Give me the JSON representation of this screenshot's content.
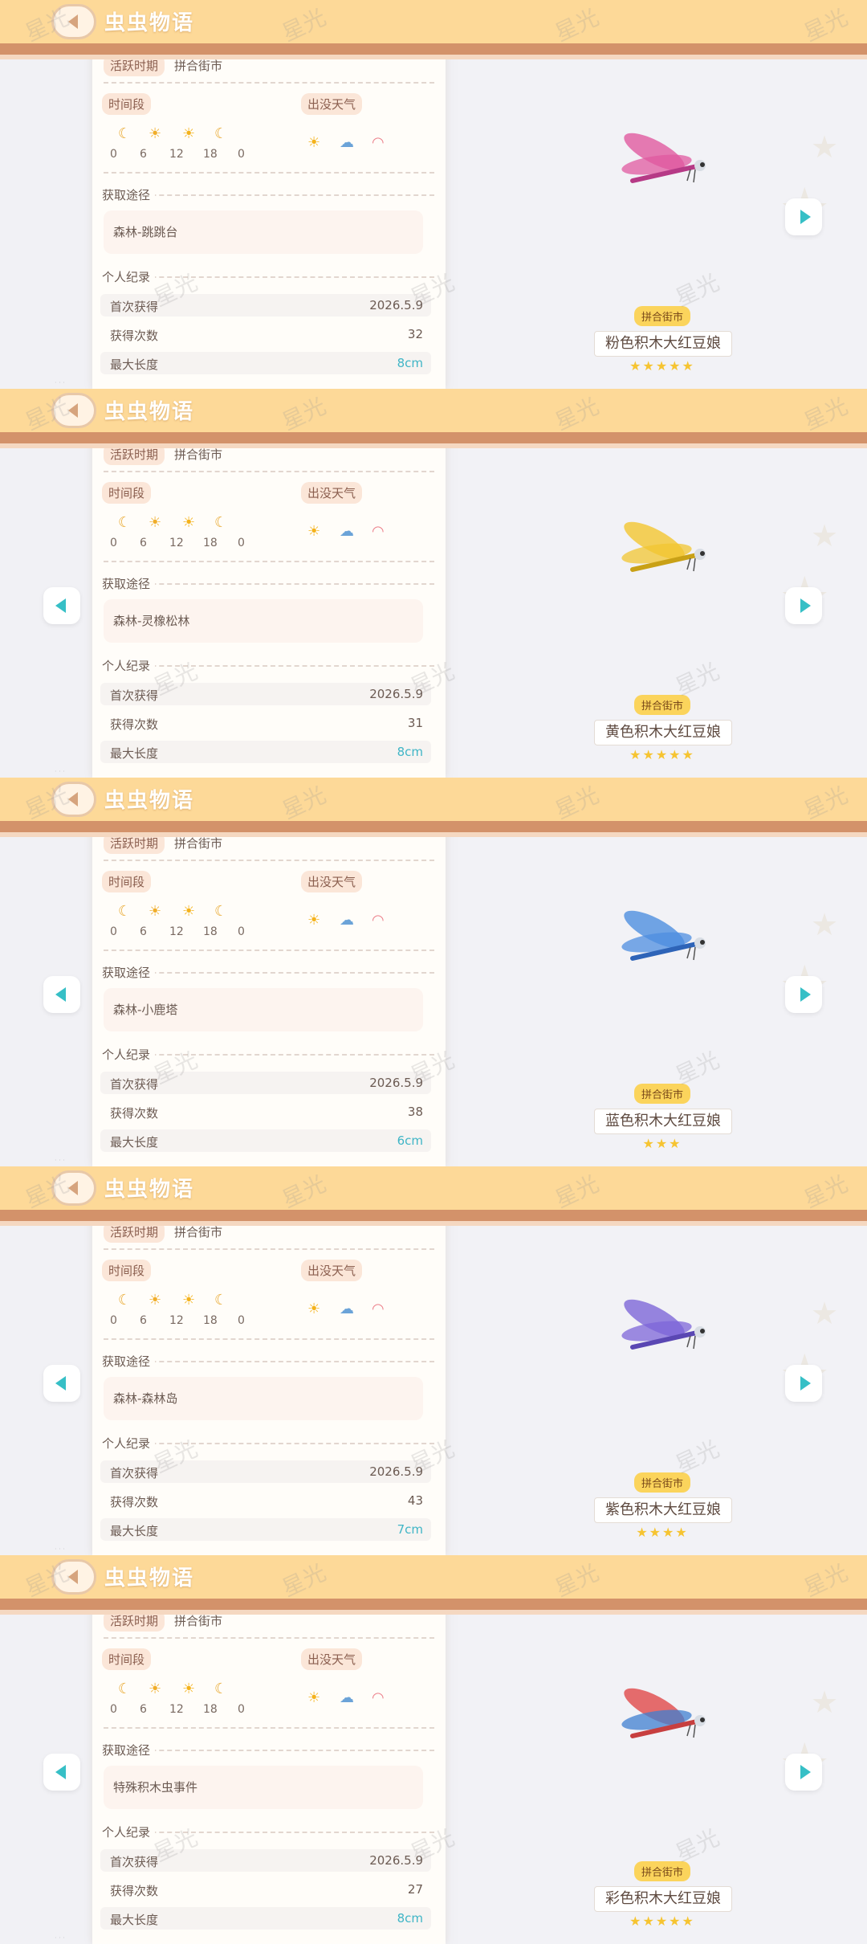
{
  "app": {
    "title": "虫虫物语"
  },
  "watermark": "星光",
  "labels": {
    "active_period": "活跃时期",
    "time_slot": "时间段",
    "weather": "出没天气",
    "source": "获取途径",
    "record": "个人纪录",
    "first_obtained": "首次获得",
    "times_obtained": "获得次数",
    "max_length": "最大长度"
  },
  "time_ticks": [
    "0",
    "6",
    "12",
    "18",
    "0"
  ],
  "icons": {
    "time": [
      "moon-icon",
      "sunrise-icon",
      "sun-icon",
      "moon-icon"
    ],
    "weather": [
      "sun-icon",
      "rain-cloud-icon",
      "rainbow-icon"
    ]
  },
  "panels": [
    {
      "period": "拼合街市",
      "source": "森林-跳跳台",
      "first_date": "2026.5.9",
      "count": "32",
      "max_length": "8cm",
      "badge": "拼合街市",
      "name": "粉色积木大红豆娘",
      "stars": "★★★★★",
      "rating": 5,
      "colors": {
        "wing": "#e05aa0",
        "body": "#b63a86"
      },
      "show_prev": false
    },
    {
      "period": "拼合街市",
      "source": "森林-灵橡松林",
      "first_date": "2026.5.9",
      "count": "31",
      "max_length": "8cm",
      "badge": "拼合街市",
      "name": "黄色积木大红豆娘",
      "stars": "★★★★★",
      "rating": 5,
      "colors": {
        "wing": "#f2c531",
        "body": "#c9a116"
      },
      "show_prev": true
    },
    {
      "period": "拼合街市",
      "source": "森林-小鹿塔",
      "first_date": "2026.5.9",
      "count": "38",
      "max_length": "6cm",
      "badge": "拼合街市",
      "name": "蓝色积木大红豆娘",
      "stars": "★★★",
      "rating": 3,
      "colors": {
        "wing": "#4d8ee0",
        "body": "#2e64b8"
      },
      "show_prev": true
    },
    {
      "period": "拼合街市",
      "source": "森林-森林岛",
      "first_date": "2026.5.9",
      "count": "43",
      "max_length": "7cm",
      "badge": "拼合街市",
      "name": "紫色积木大红豆娘",
      "stars": "★★★★",
      "rating": 4,
      "colors": {
        "wing": "#7d66d8",
        "body": "#5a47b3"
      },
      "show_prev": true
    },
    {
      "period": "拼合街市",
      "source": "特殊积木虫事件",
      "first_date": "2026.5.9",
      "count": "27",
      "max_length": "8cm",
      "badge": "拼合街市",
      "name": "彩色积木大红豆娘",
      "stars": "★★★★★",
      "rating": 5,
      "colors": {
        "wing": "#e0494a",
        "wing2": "#3f7fd0",
        "body": "#c73f3f"
      },
      "show_prev": true
    }
  ]
}
